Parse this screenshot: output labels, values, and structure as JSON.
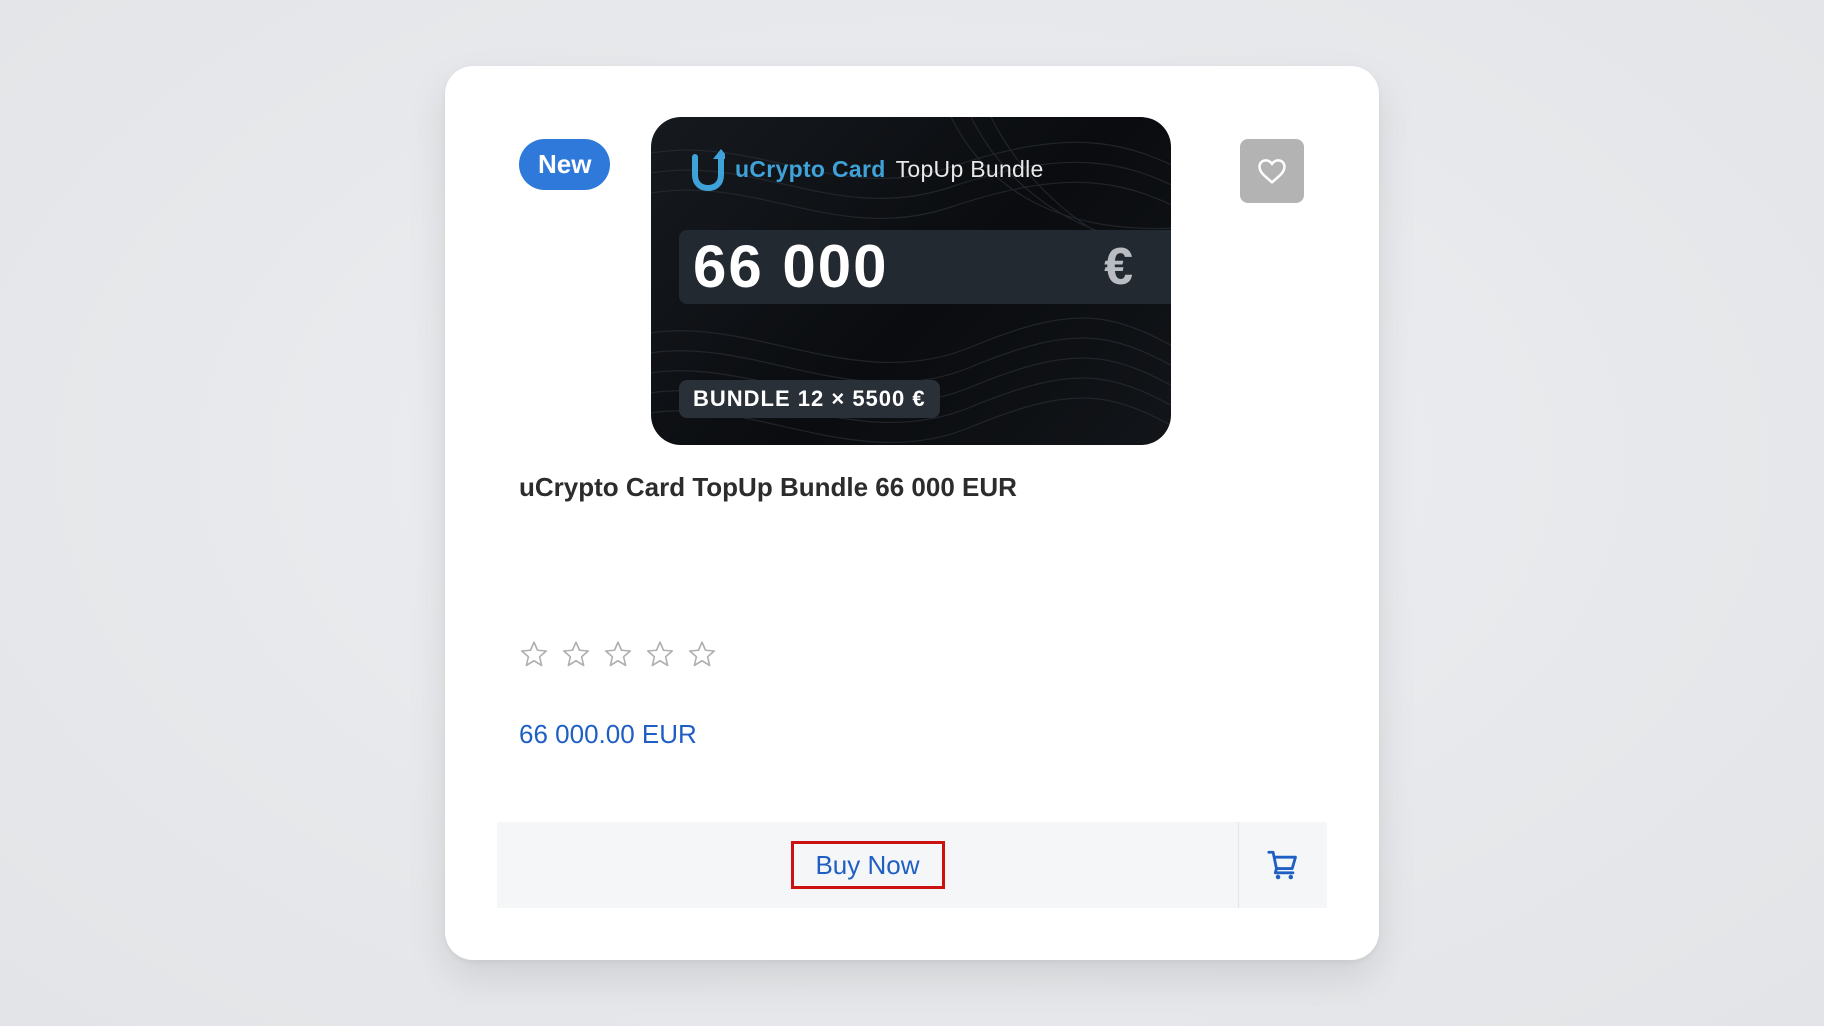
{
  "card": {
    "badge": "New",
    "image": {
      "brand_accent": "uCrypto Card",
      "brand_rest": "TopUp Bundle",
      "amount": "66 000",
      "currency_symbol": "€",
      "bundle_label": "BUNDLE 12 × 5500 €"
    },
    "title": "uCrypto Card TopUp Bundle 66 000 EUR",
    "rating": {
      "filled": 0,
      "max": 5
    },
    "price": "66 000.00 EUR",
    "buy_label": "Buy Now",
    "wishlist_icon": "heart-icon",
    "cart_icon": "cart-icon"
  },
  "colors": {
    "accent": "#2e79d9",
    "price": "#1f5fc4",
    "highlight": "#cc1111"
  }
}
